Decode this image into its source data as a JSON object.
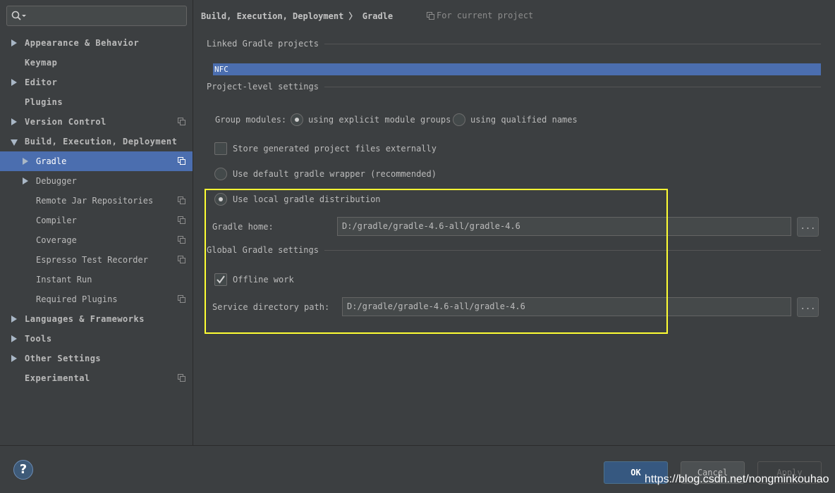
{
  "sidebar": {
    "search": {
      "value": ""
    },
    "items": [
      {
        "label": "Appearance & Behavior"
      },
      {
        "label": "Keymap"
      },
      {
        "label": "Editor"
      },
      {
        "label": "Plugins"
      },
      {
        "label": "Version Control"
      },
      {
        "label": "Build, Execution, Deployment"
      },
      {
        "label": "Gradle"
      },
      {
        "label": "Debugger"
      },
      {
        "label": "Remote Jar Repositories"
      },
      {
        "label": "Compiler"
      },
      {
        "label": "Coverage"
      },
      {
        "label": "Espresso Test Recorder"
      },
      {
        "label": "Instant Run"
      },
      {
        "label": "Required Plugins"
      },
      {
        "label": "Languages & Frameworks"
      },
      {
        "label": "Tools"
      },
      {
        "label": "Other Settings"
      },
      {
        "label": "Experimental"
      }
    ]
  },
  "header": {
    "breadcrumb_parent": "Build, Execution, Deployment",
    "breadcrumb_separator": "〉",
    "breadcrumb_current": "Gradle",
    "scope": "For current project"
  },
  "linked": {
    "title": "Linked Gradle projects",
    "project": "NFC"
  },
  "project_level": {
    "title": "Project-level settings",
    "group_modules_label": "Group modules:",
    "option_explicit": "using explicit module groups",
    "option_qualified": "using qualified names",
    "store_external": "Store generated project files externally",
    "use_wrapper": "Use default gradle wrapper (recommended)",
    "use_local": "Use local gradle distribution",
    "gradle_home_label": "Gradle home:",
    "gradle_home_value": "D:/gradle/gradle-4.6-all/gradle-4.6",
    "browse": "..."
  },
  "global": {
    "title": "Global Gradle settings",
    "offline": "Offline work",
    "service_dir_label": "Service directory path:",
    "service_dir_value": "D:/gradle/gradle-4.6-all/gradle-4.6",
    "browse": "..."
  },
  "footer": {
    "help": "?",
    "ok": "OK",
    "cancel": "Cancel",
    "apply": "Apply",
    "watermark": "https://blog.csdn.net/nongminkouhao"
  },
  "colors": {
    "selection": "#4b6eaf",
    "highlight_box": "#ffff33",
    "background": "#3c3f41"
  }
}
